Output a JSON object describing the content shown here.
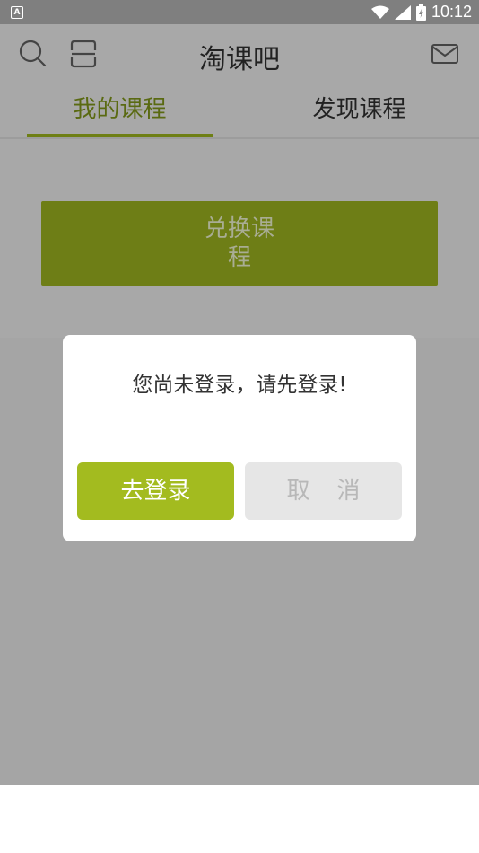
{
  "status_bar": {
    "time": "10:12",
    "app_badge": "A"
  },
  "header": {
    "title": "淘课吧",
    "icons": [
      "search-icon",
      "scan-icon",
      "mail-icon"
    ]
  },
  "tabs": [
    {
      "label": "我的课程",
      "active": true
    },
    {
      "label": "发现课程",
      "active": false
    }
  ],
  "main": {
    "exchange_button": "兑换课程"
  },
  "dialog": {
    "message": "您尚未登录，请先登录!",
    "confirm_label": "去登录",
    "cancel_label": "取消"
  },
  "colors": {
    "accent": "#a3bb1f",
    "accent_dark": "#6e7e16",
    "overlay": "#a5a5a5"
  }
}
